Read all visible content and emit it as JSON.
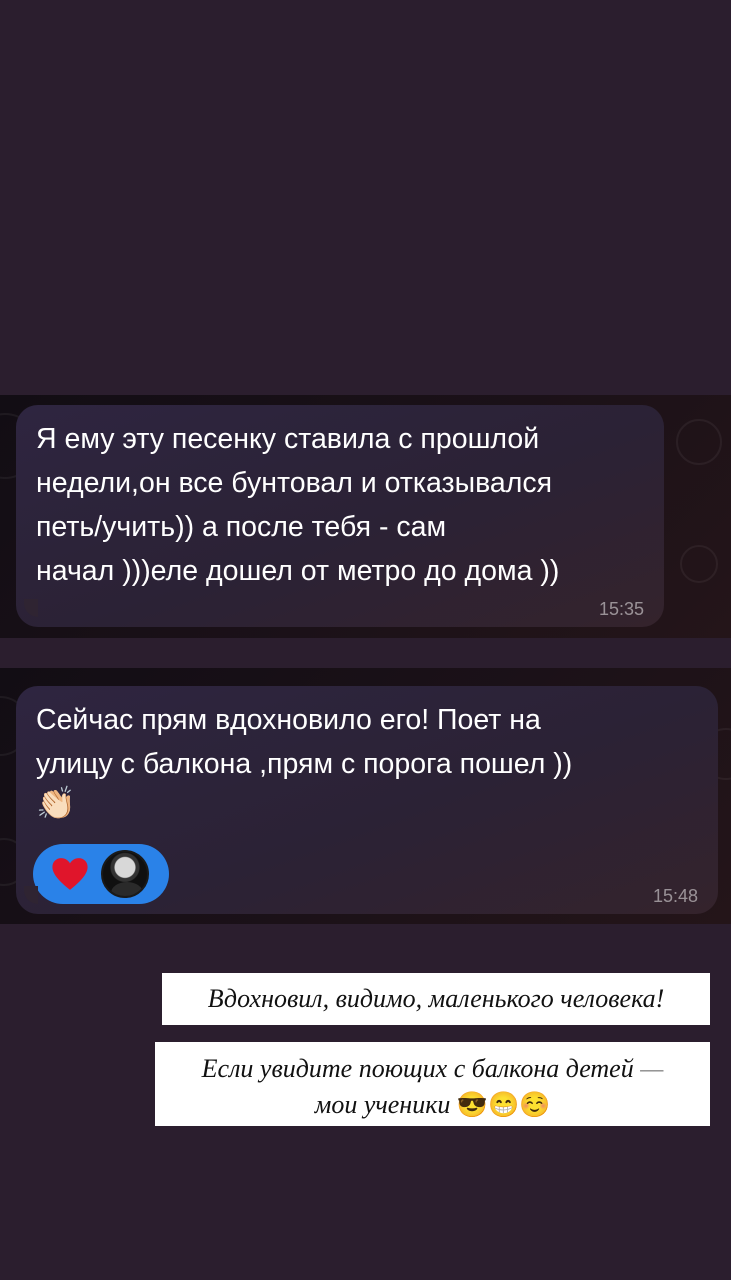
{
  "messages": [
    {
      "text": "Я ему эту песенку ставила с прошлой\nнедели,он все бунтовал и отказывался\nпеть/учить)) а после тебя - сам\nначал )))еле дошел от метро до дома ))",
      "time": "15:35"
    },
    {
      "text": "Сейчас прям вдохновило его! Поет на\nулицу с балкона ,прям с порога пошел ))",
      "emoji": "👏🏻",
      "time": "15:48",
      "reaction": {
        "icon": "red-heart-icon",
        "color": "#2a82e8"
      }
    }
  ],
  "captions": [
    {
      "text": "Вдохновил, видимо, маленького человека!"
    },
    {
      "line1": "Если увидите поющих с балкона детей",
      "dash": "—",
      "line2": "мои ученики",
      "emoji": "😎😁☺️"
    }
  ]
}
